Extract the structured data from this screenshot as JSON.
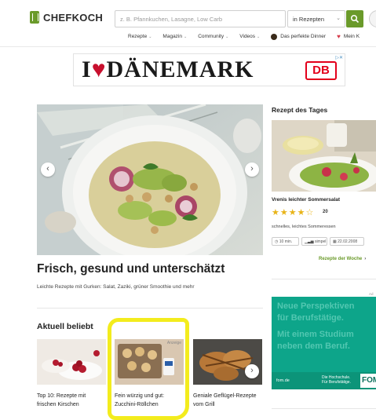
{
  "header": {
    "logo_text": "CHEFKOCH",
    "search_placeholder": "z. B. Pfannkuchen, Lasagne, Low Carb",
    "scope_value": "in Rezepten",
    "nav": [
      {
        "label": "Rezepte"
      },
      {
        "label": "Magazin"
      },
      {
        "label": "Community"
      },
      {
        "label": "Videos"
      },
      {
        "label": "Das perfekte Dinner"
      },
      {
        "label": "Mein K"
      }
    ]
  },
  "ad_banner": {
    "text_prefix": "I",
    "text_main": "DÄNEMARK",
    "brand": "DB",
    "adchoices": "▷✕"
  },
  "hero": {
    "title": "Frisch, gesund und unterschätzt",
    "subtitle": "Leichte Rezepte mit Gurken: Salat, Zaziki, grüner Smoothie und mehr"
  },
  "popular": {
    "title": "Aktuell beliebt",
    "items": [
      {
        "label": "Top 10: Rezepte mit frischen Kirschen"
      },
      {
        "label": "Fein würzig und gut: Zucchini-Röllchen",
        "tag": "Anzeige"
      },
      {
        "label": "Geniale Geflügel-Rezepte vom Grill"
      }
    ]
  },
  "recipe_of_day": {
    "heading": "Rezept des Tages",
    "name": "Vrenis leichter Sommersalat",
    "rating": 4,
    "stars": "★★★★☆",
    "rating_count": "20",
    "description": "schnelles, leichtes Sommeressen",
    "chips": [
      "10 min.",
      "simpel",
      "22.02.2008"
    ],
    "link": "Rezepte der Woche",
    "link_arrow": "›"
  },
  "side_ad": {
    "marker": "Ad",
    "line1": "Neue Perspektiven",
    "line2": "für Berufstätige.",
    "line3": "Mit einem Studium",
    "line4": "neben dem Beruf.",
    "site": "fom.de",
    "claim1": "Die Hochschule.",
    "claim2": "Für Berufstätige.",
    "logo": "FOM"
  },
  "colors": {
    "brand_green": "#6a9a2a",
    "annotation_yellow": "#f3ec1d",
    "star": "#e8b419",
    "ad_teal": "#0da58a"
  }
}
